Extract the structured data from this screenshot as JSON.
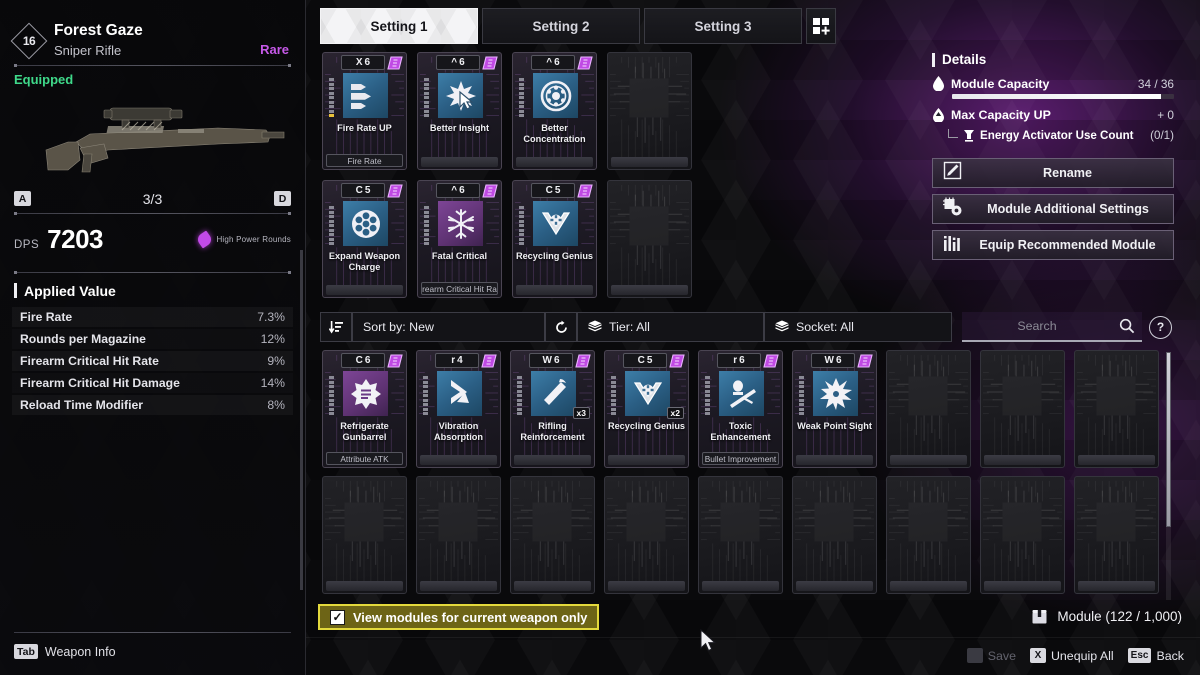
{
  "weapon": {
    "level": "16",
    "name": "Forest Gaze",
    "type": "Sniper Rifle",
    "rarity": "Rare",
    "status": "Equipped",
    "key_left": "A",
    "key_right": "D",
    "page_indicator": "3/3",
    "dps_label": "DPS",
    "dps_value": "7203",
    "element_label": "High Power Rounds",
    "rarity_color": "#c659e8",
    "status_color": "#3fd98a"
  },
  "applied_value": {
    "title": "Applied Value",
    "stats": [
      {
        "name": "Fire Rate",
        "value": "7.3%"
      },
      {
        "name": "Rounds per Magazine",
        "value": "12%"
      },
      {
        "name": "Firearm Critical Hit Rate",
        "value": "9%"
      },
      {
        "name": "Firearm Critical Hit Damage",
        "value": "14%"
      },
      {
        "name": "Reload Time Modifier",
        "value": "8%"
      }
    ]
  },
  "left_footer": {
    "key": "Tab",
    "label": "Weapon Info"
  },
  "tabs": {
    "items": [
      {
        "label": "Setting 1",
        "active": true
      },
      {
        "label": "Setting 2",
        "active": false
      },
      {
        "label": "Setting 3",
        "active": false
      }
    ],
    "add_icon": "add-preset-icon"
  },
  "equipped_modules": [
    {
      "socket": "X",
      "cost": "6",
      "name": "Fire Rate UP",
      "tag": "Fire Rate",
      "icon": "bullets-icon",
      "iconStyle": "blue",
      "energy": 9,
      "energyLit": 1,
      "empty": false
    },
    {
      "socket": "^",
      "cost": "6",
      "name": "Better Insight",
      "tag": "",
      "icon": "cursor-star-icon",
      "iconStyle": "blue",
      "energy": 9,
      "energyLit": 0,
      "empty": false
    },
    {
      "socket": "^",
      "cost": "6",
      "name": "Better Concentration",
      "tag": "",
      "icon": "gear-ring-icon",
      "iconStyle": "blue",
      "energy": 9,
      "energyLit": 0,
      "empty": false
    },
    {
      "empty": true
    },
    {
      "socket": "C",
      "cost": "5",
      "name": "Expand Weapon Charge",
      "tag": "",
      "icon": "cylinder-icon",
      "iconStyle": "blue",
      "energy": 9,
      "energyLit": 0,
      "empty": false
    },
    {
      "socket": "^",
      "cost": "6",
      "name": "Fatal Critical",
      "tag": "Firearm Critical Hit Rate",
      "icon": "snowflake-icon",
      "iconStyle": "purp",
      "energy": 9,
      "energyLit": 0,
      "empty": false
    },
    {
      "socket": "C",
      "cost": "5",
      "name": "Recycling Genius",
      "tag": "",
      "icon": "recycle-arrow-icon",
      "iconStyle": "blue",
      "energy": 9,
      "energyLit": 0,
      "empty": false
    },
    {
      "empty": true
    }
  ],
  "details": {
    "title": "Details",
    "module_capacity": {
      "icon": "droplet-icon",
      "label": "Module Capacity",
      "value": "34 / 36",
      "percent": 94
    },
    "max_capacity_up": {
      "icon": "capacity-up-icon",
      "label": "Max Capacity UP",
      "value": "+ 0"
    },
    "energy_activator": {
      "icon": "activator-icon",
      "label": "Energy Activator Use Count",
      "value": "(0/1)"
    },
    "buttons": [
      {
        "label": "Rename",
        "icon": "pencil-icon"
      },
      {
        "label": "Module Additional Settings",
        "icon": "module-settings-icon"
      },
      {
        "label": "Equip Recommended Module",
        "icon": "bar-chart-icon"
      }
    ]
  },
  "toolbar": {
    "sort_icon": "sort-descending-icon",
    "sort_label": "Sort by: New",
    "reset_icon": "reset-icon",
    "tier_icon": "layers-icon",
    "tier_label": "Tier: All",
    "socket_icon": "layers-icon",
    "socket_label": "Socket: All",
    "search_placeholder": "Search",
    "search_value": "",
    "search_icon": "search-icon",
    "help_label": "?"
  },
  "inventory_modules": [
    {
      "socket": "C",
      "cost": "6",
      "name": "Refrigerate Gunbarrel",
      "tag": "Attribute ATK",
      "icon": "burst-lines-icon",
      "iconStyle": "purp",
      "energy": 9,
      "qty": "",
      "empty": false
    },
    {
      "socket": "r",
      "cost": "4",
      "name": "Vibration Absorption",
      "tag": "",
      "icon": "chevron-arrow-icon",
      "iconStyle": "blue",
      "energy": 9,
      "qty": "",
      "empty": false
    },
    {
      "socket": "W",
      "cost": "6",
      "name": "Rifling Reinforcement",
      "tag": "",
      "icon": "barrel-icon",
      "iconStyle": "blue",
      "energy": 9,
      "qty": "x3",
      "empty": false
    },
    {
      "socket": "C",
      "cost": "5",
      "name": "Recycling Genius",
      "tag": "",
      "icon": "recycle-arrow-icon",
      "iconStyle": "blue",
      "energy": 9,
      "qty": "x2",
      "empty": false
    },
    {
      "socket": "r",
      "cost": "6",
      "name": "Toxic Enhancement",
      "tag": "Bullet Improvement",
      "icon": "toxic-icon",
      "iconStyle": "blue",
      "energy": 9,
      "qty": "",
      "empty": false
    },
    {
      "socket": "W",
      "cost": "6",
      "name": "Weak Point Sight",
      "tag": "",
      "icon": "weakpoint-icon",
      "iconStyle": "blue",
      "energy": 9,
      "qty": "",
      "empty": false
    },
    {
      "empty": true
    },
    {
      "empty": true
    },
    {
      "empty": true
    },
    {
      "empty": true
    },
    {
      "empty": true
    },
    {
      "empty": true
    },
    {
      "empty": true
    },
    {
      "empty": true
    },
    {
      "empty": true
    },
    {
      "empty": true
    },
    {
      "empty": true
    },
    {
      "empty": true
    }
  ],
  "footer": {
    "checkbox_label": "View modules for current weapon only",
    "checkbox_checked": true,
    "module_count_label": "Module (122 / 1,000)",
    "module_count_icon": "box-icon",
    "hints": [
      {
        "key": "",
        "label": "Save",
        "dim": true
      },
      {
        "key": "X",
        "label": "Unequip All",
        "dim": false
      },
      {
        "key": "Esc",
        "label": "Back",
        "dim": false
      }
    ]
  }
}
